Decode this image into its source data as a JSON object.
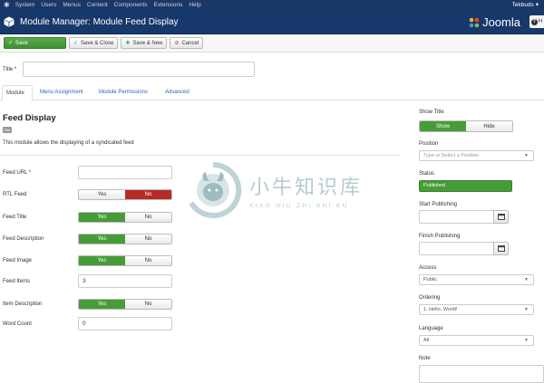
{
  "topnav": {
    "items": [
      "System",
      "Users",
      "Menus",
      "Content",
      "Components",
      "Extensions",
      "Help"
    ],
    "user": "Tekbuds"
  },
  "header": {
    "title": "Module Manager: Module Feed Display",
    "brand": "Joomla",
    "help_label": "H"
  },
  "toolbar": {
    "save": "Save",
    "save_close": "Save & Close",
    "save_new": "Save & New",
    "cancel": "Cancel"
  },
  "title_field": {
    "label": "Title *",
    "value": ""
  },
  "tabs": [
    "Module",
    "Menu Assignment",
    "Module Permissions",
    "Advanced"
  ],
  "module": {
    "heading": "Feed Display",
    "badge": "Site",
    "description": "This module allows the displaying of a syndicated feed"
  },
  "fields": {
    "feed_url": {
      "label": "Feed URL *",
      "value": ""
    },
    "rtl_feed": {
      "label": "RTL Feed",
      "yes": "Yes",
      "no": "No",
      "selected": "No"
    },
    "feed_title": {
      "label": "Feed Title",
      "yes": "Yes",
      "no": "No",
      "selected": "Yes"
    },
    "feed_description": {
      "label": "Feed Description",
      "yes": "Yes",
      "no": "No",
      "selected": "Yes"
    },
    "feed_image": {
      "label": "Feed Image",
      "yes": "Yes",
      "no": "No",
      "selected": "Yes"
    },
    "feed_items": {
      "label": "Feed Items",
      "value": "3"
    },
    "item_description": {
      "label": "Item Description",
      "yes": "Yes",
      "no": "No",
      "selected": "Yes"
    },
    "word_count": {
      "label": "Word Count",
      "value": "0"
    }
  },
  "sidebar": {
    "show_title": {
      "label": "Show Title",
      "show": "Show",
      "hide": "Hide",
      "selected": "Show"
    },
    "position": {
      "label": "Position",
      "placeholder": "Type or Select a Position"
    },
    "status": {
      "label": "Status",
      "value": "Published"
    },
    "start_publishing": {
      "label": "Start Publishing",
      "value": ""
    },
    "finish_publishing": {
      "label": "Finish Publishing",
      "value": ""
    },
    "access": {
      "label": "Access",
      "value": "Public"
    },
    "ordering": {
      "label": "Ordering",
      "value": "1. Hello, World!"
    },
    "language": {
      "label": "Language",
      "value": "All"
    },
    "note": {
      "label": "Note",
      "value": ""
    }
  },
  "watermark": {
    "cn": "小牛知识库",
    "pinyin": "XIAO NIU ZHI SHI KU"
  },
  "colors": {
    "nav_bg": "#1a3867",
    "header_bg": "#17386a",
    "success": "#469c37",
    "danger": "#b52b27",
    "link": "#2a69b8"
  }
}
